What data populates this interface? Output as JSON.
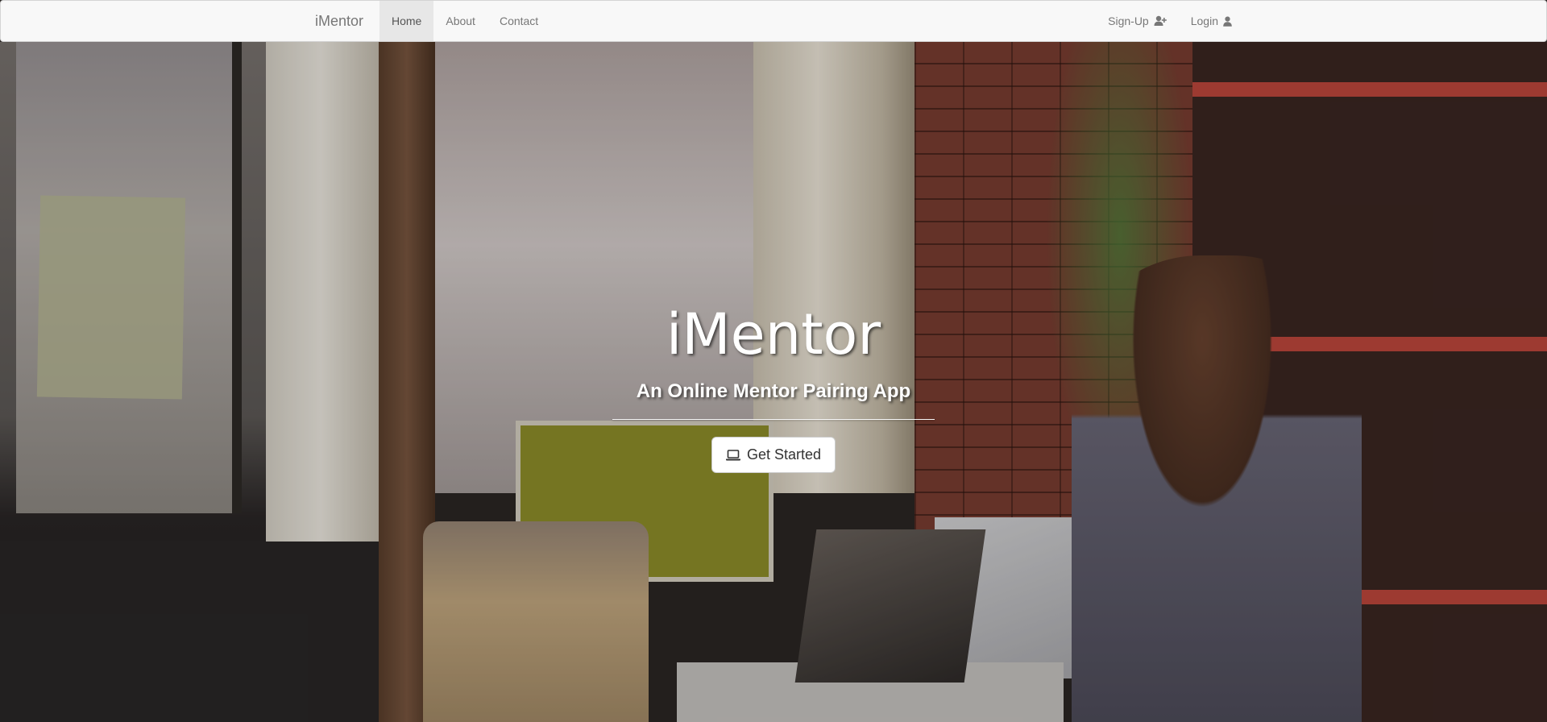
{
  "navbar": {
    "brand": "iMentor",
    "links": [
      {
        "label": "Home",
        "active": true
      },
      {
        "label": "About",
        "active": false
      },
      {
        "label": "Contact",
        "active": false
      }
    ],
    "right_links": [
      {
        "label": "Sign-Up",
        "icon": "user-plus-icon"
      },
      {
        "label": "Login",
        "icon": "user-icon"
      }
    ]
  },
  "hero": {
    "title": "iMentor",
    "subtitle": "An Online Mentor Pairing App",
    "cta_label": "Get Started",
    "cta_icon": "laptop-icon"
  },
  "colors": {
    "navbar_bg": "#f8f8f8",
    "navbar_text": "#777777",
    "active_tab_bg": "#e7e7e7",
    "hero_text": "#ffffff"
  }
}
